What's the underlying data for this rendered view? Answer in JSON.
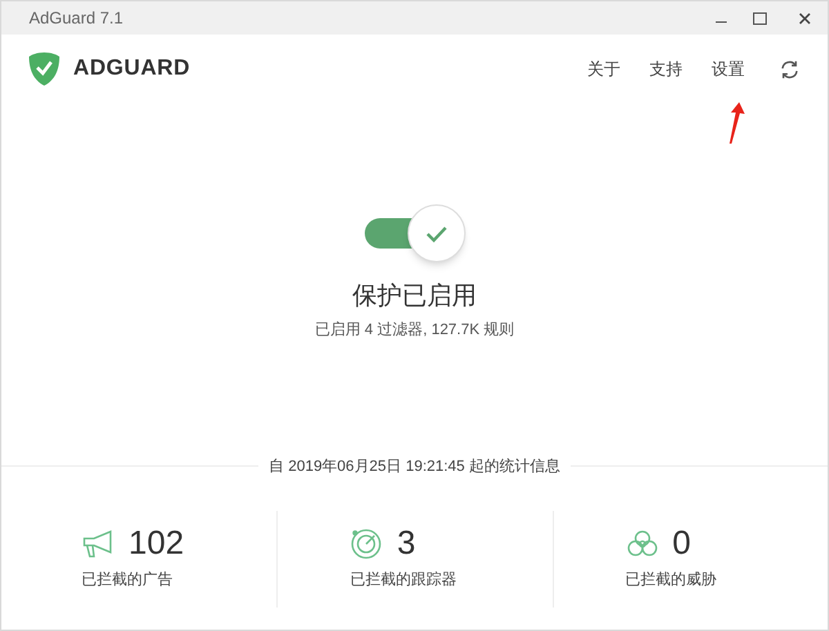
{
  "window": {
    "title": "AdGuard 7.1"
  },
  "header": {
    "logo_text": "ADGUARD",
    "nav": [
      "关于",
      "支持",
      "设置"
    ]
  },
  "protection": {
    "on": true,
    "title": "保护已启用",
    "subtitle": "已启用 4 过滤器, 127.7K 规则"
  },
  "stats": {
    "caption": "自 2019年06月25日 19:21:45 起的统计信息",
    "items": [
      {
        "kind": "ads",
        "value": "102",
        "label": "已拦截的广告"
      },
      {
        "kind": "trackers",
        "value": "3",
        "label": "已拦截的跟踪器"
      },
      {
        "kind": "threats",
        "value": "0",
        "label": "已拦截的威胁"
      }
    ]
  }
}
